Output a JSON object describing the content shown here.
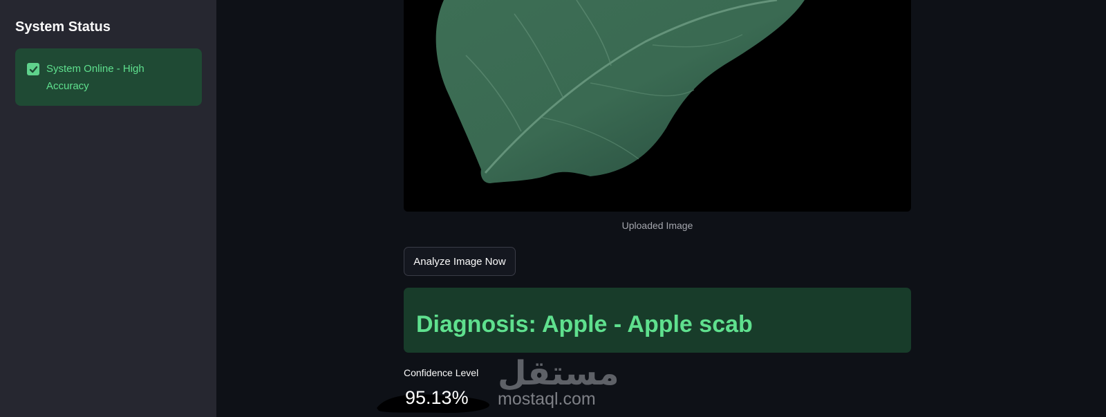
{
  "sidebar": {
    "title": "System Status",
    "status_message": "System Online - High Accuracy",
    "status_icon": "check-icon"
  },
  "main": {
    "image_caption": "Uploaded Image",
    "analyze_button_label": "Analyze Image Now",
    "diagnosis_text": "Diagnosis: Apple - Apple scab",
    "metric_label": "Confidence Level",
    "metric_value": "95.13%"
  },
  "watermark": {
    "arabic_text": "مستقل",
    "latin_text": "mostaql.com"
  },
  "colors": {
    "sidebar_bg": "#262730",
    "app_bg": "#0e1117",
    "success_text": "#5fe08e",
    "success_box": "#1f4a34",
    "diagnosis_box": "#183c2a"
  }
}
